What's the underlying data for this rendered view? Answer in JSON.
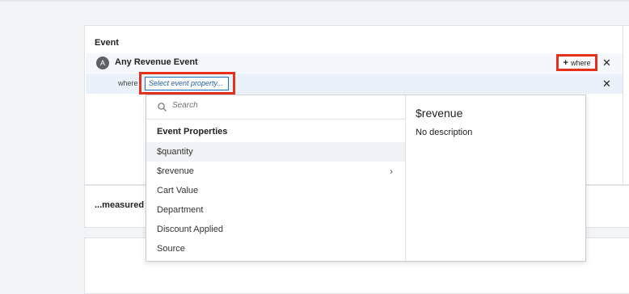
{
  "event_section": {
    "title": "Event",
    "event": {
      "badge": "A",
      "name": "Any Revenue Event",
      "add_where_label": "where"
    },
    "filter": {
      "where_label": "where",
      "property_placeholder": "Select event property..."
    }
  },
  "measured_section": {
    "title": "...measured"
  },
  "dropdown": {
    "search_placeholder": "Search",
    "group_label": "Event Properties",
    "options": [
      {
        "label": "$quantity"
      },
      {
        "label": "$revenue"
      },
      {
        "label": "Cart Value"
      },
      {
        "label": "Department"
      },
      {
        "label": "Discount Applied"
      },
      {
        "label": "Source"
      }
    ],
    "detail": {
      "title": "$revenue",
      "description": "No description"
    }
  },
  "colors": {
    "highlight": "#e5301c",
    "accent": "#1f70c1"
  },
  "icons": {
    "search": "search-icon",
    "close": "close-icon",
    "plus": "plus-icon",
    "chevron": "chevron-right-icon"
  }
}
